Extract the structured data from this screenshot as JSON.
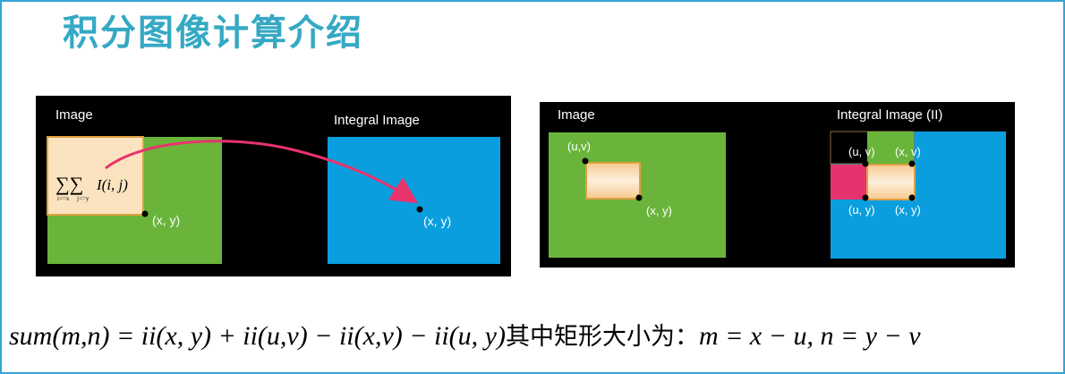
{
  "title": "积分图像计算介绍",
  "left_panel": {
    "image_label": "Image",
    "integral_label": "Integral Image",
    "sum_formula": "ΣΣ I(i, j)",
    "sum_subscript_i": "i<=x",
    "sum_subscript_j": "j<=y",
    "point_image": "(x, y)",
    "point_integral": "(x, y)",
    "colors": {
      "green": "#6ab43b",
      "blue": "#0b9ede",
      "arrow": "#e8336d",
      "highlight": "#fbe3bf"
    }
  },
  "right_panel": {
    "image_label": "Image",
    "integral_label": "Integral Image (II)",
    "img_point_uv": "(u,v)",
    "img_point_xy": "(x, y)",
    "ii_point_uv": "(u, v)",
    "ii_point_xv": "(x, v)",
    "ii_point_uy": "(u, y)",
    "ii_point_xy": "(x, y)",
    "colors": {
      "pink": "#e8326e"
    }
  },
  "formula": {
    "lhs": "sum(m,n) = ii(x, y) + ii(u,v) − ii(x,v) − ii(u, y)",
    "chinese": "其中矩形大小为：",
    "rhs": "m = x − u, n = y − v"
  }
}
